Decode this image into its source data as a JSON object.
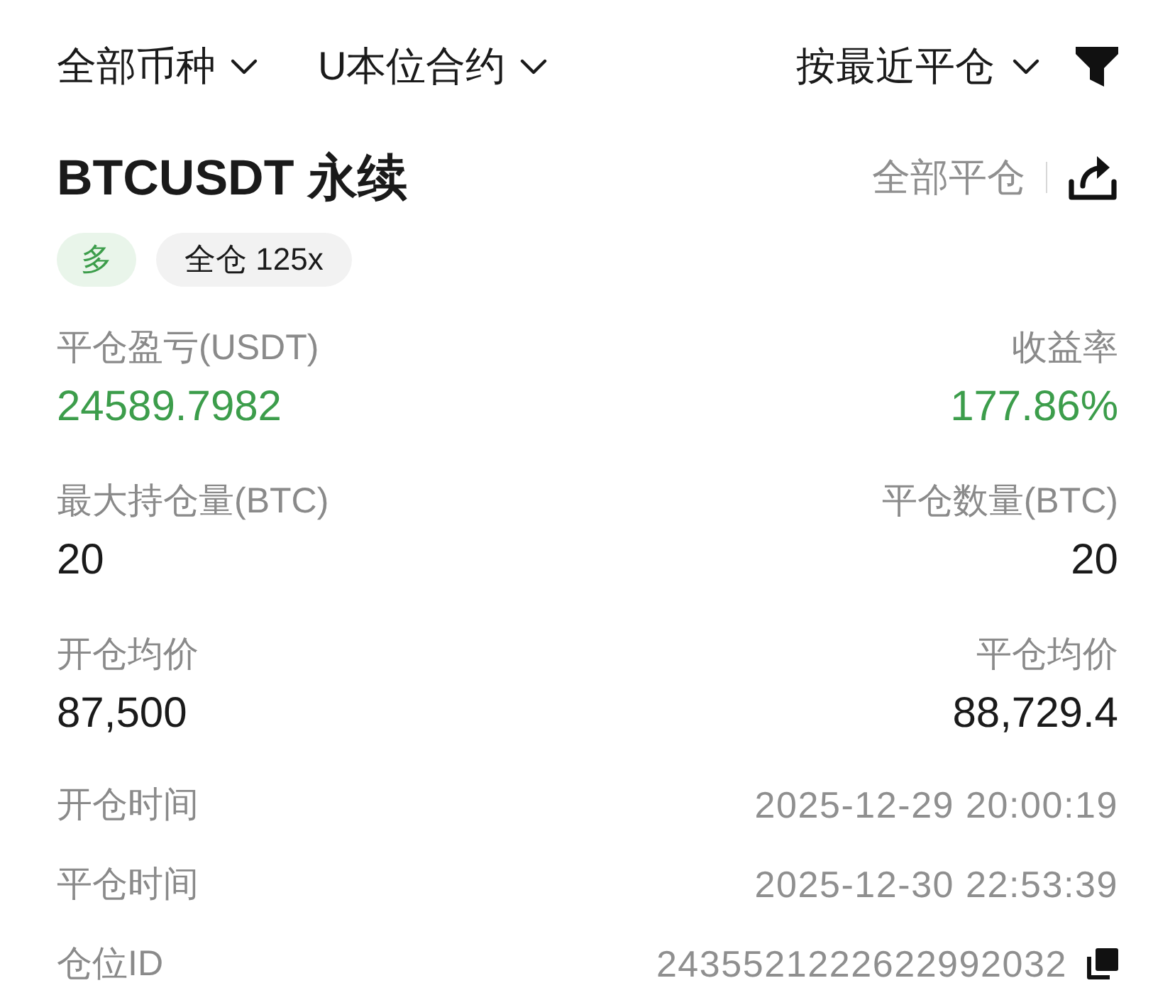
{
  "filters": [
    {
      "label": "全部币种"
    },
    {
      "label": "U本位合约"
    }
  ],
  "sort": {
    "label": "按最近平仓"
  },
  "position": {
    "title": "BTCUSDT 永续",
    "close_all": "全部平仓",
    "tags": [
      {
        "kind": "side",
        "label": "多"
      },
      {
        "kind": "margin",
        "label": "全仓 125x"
      }
    ]
  },
  "stats": [
    {
      "left": {
        "label": "平仓盈亏(USDT)",
        "value": "24589.7982",
        "color": "#3c9d4b"
      },
      "right": {
        "label": "收益率",
        "value": "177.86%",
        "color": "#3c9d4b"
      }
    },
    {
      "left": {
        "label": "最大持仓量(BTC)",
        "value": "20",
        "color": "#1a1a1a"
      },
      "right": {
        "label": "平仓数量(BTC)",
        "value": "20",
        "color": "#1a1a1a"
      }
    },
    {
      "left": {
        "label": "开仓均价",
        "value": "87,500",
        "color": "#1a1a1a"
      },
      "right": {
        "label": "平仓均价",
        "value": "88,729.4",
        "color": "#1a1a1a"
      }
    }
  ],
  "details": [
    {
      "label": "开仓时间",
      "value": "2025-12-29 20:00:19",
      "copyable": false
    },
    {
      "label": "平仓时间",
      "value": "2025-12-30 22:53:39",
      "copyable": false
    },
    {
      "label": "仓位ID",
      "value": "2435521222622992032",
      "copyable": true
    }
  ]
}
